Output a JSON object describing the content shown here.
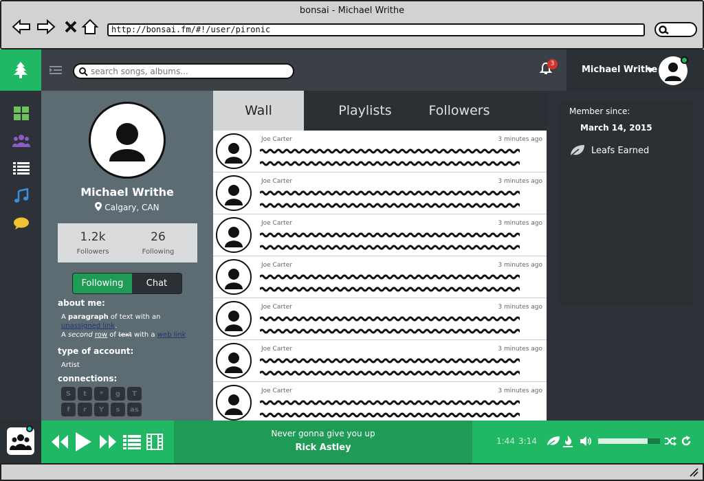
{
  "window": {
    "title": "bonsai - Michael Writhe"
  },
  "browser": {
    "url": "http://bonsai.fm/#!/user/pironic"
  },
  "header": {
    "search_placeholder": "search songs, albums...",
    "notification_count": "3",
    "user_name": "Michael Writhe"
  },
  "profile": {
    "name": "Michael Writhe",
    "location": "Calgary, CAN",
    "followers_count": "1.2k",
    "followers_label": "Followers",
    "following_count": "26",
    "following_label": "Following",
    "following_button": "Following",
    "chat_button": "Chat",
    "about_title": "about me:",
    "about_1a": "A ",
    "about_1b": "paragraph",
    "about_1c": " of text with an",
    "about_link_unassigned": "unassigned link",
    "about_link_unassigned_tail": ".",
    "about_2a": "A ",
    "about_2b": "second",
    "about_2c": "row",
    "about_2d": " of ",
    "about_2e": "text",
    "about_2f": " with a ",
    "about_link_web": "web link",
    "account_title": "type of account:",
    "account_type": "Artist",
    "connections_title": "connections:",
    "connections": [
      {
        "icon": "steam-icon",
        "glyph": "S"
      },
      {
        "icon": "twitter-icon",
        "glyph": "t"
      },
      {
        "icon": "snowflake-icon",
        "glyph": "*"
      },
      {
        "icon": "github-icon",
        "glyph": "g"
      },
      {
        "icon": "twitch-icon",
        "glyph": "T"
      },
      {
        "icon": "facebook-icon",
        "glyph": "f"
      },
      {
        "icon": "reddit-icon",
        "glyph": "r"
      },
      {
        "icon": "youtube-icon",
        "glyph": "Y"
      },
      {
        "icon": "skype-icon",
        "glyph": "s"
      },
      {
        "icon": "lastfm-icon",
        "glyph": "as"
      }
    ]
  },
  "tabs": [
    "Wall",
    "Playlists",
    "Followers"
  ],
  "wall": {
    "posts": [
      {
        "author": "Joe Carter",
        "time": "3 minutes ago"
      },
      {
        "author": "Joe Carter",
        "time": "3 minutes ago"
      },
      {
        "author": "Joe Carter",
        "time": "3 minutes ago"
      },
      {
        "author": "Joe Carter",
        "time": "3 minutes ago"
      },
      {
        "author": "Joe Carter",
        "time": "3 minutes ago"
      },
      {
        "author": "Joe Carter",
        "time": "3 minutes ago"
      },
      {
        "author": "Joe Carter",
        "time": "3 minutes ago"
      }
    ]
  },
  "member": {
    "since_label": "Member since:",
    "since_date": "March 14, 2015",
    "leafs_label": "Leafs Earned"
  },
  "player": {
    "song_title": "Never gonna give you up",
    "artist": "Rick Astley",
    "current_time": "1:44",
    "total_time": "3:14",
    "volume": 0.8
  },
  "colors": {
    "accent": "#20b864",
    "accent_dark": "#1f9b55",
    "sidebar": "#2c3237",
    "profile_bg": "#5d6b73",
    "badge": "#d8322f",
    "grid_icon": "#6fc05f",
    "users_icon": "#8b5cc5",
    "music_icon": "#3b8fd9",
    "chat_icon": "#f1c232"
  }
}
